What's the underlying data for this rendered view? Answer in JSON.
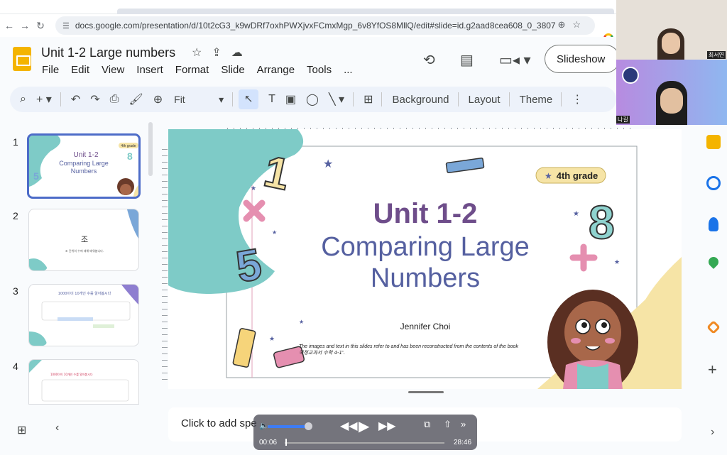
{
  "browser": {
    "url": "docs.google.com/presentation/d/10t2cG3_k9wDRf7oxhPWXjvxFCmxMgp_6v8YfOS8MllQ/edit#slide=id.g2aad8cea608_0_3807"
  },
  "doc": {
    "title": "Unit 1-2 Large numbers",
    "menu": [
      "File",
      "Edit",
      "View",
      "Insert",
      "Format",
      "Slide",
      "Arrange",
      "Tools",
      "..."
    ],
    "slideshow_label": "Slideshow"
  },
  "toolbar": {
    "zoom": "Fit",
    "background": "Background",
    "layout": "Layout",
    "theme": "Theme"
  },
  "thumbnails": [
    {
      "num": "1",
      "line1": "Unit 1-2",
      "line2": "Comparing Large",
      "line3": "Numbers",
      "badge": "4th grade",
      "selected": true
    },
    {
      "num": "2",
      "char": "조",
      "sub": "조 단위의 수에 대해 배워봅니다."
    },
    {
      "num": "3",
      "title": "1000이이 10개인 수를 알아봅시다"
    },
    {
      "num": "4",
      "title": "1000이이 10개인 수를 알아봅시다"
    }
  ],
  "slide": {
    "badge": "4th grade",
    "title_line1": "Unit 1-2",
    "title_line2": "Comparing Large",
    "title_line3": "Numbers",
    "author": "Jennifer Choi",
    "note_line1": "The images and text in this slides  refer to and has been reconstructed from the contents of the book",
    "note_line2": "국정교과서 수학 4-1'."
  },
  "notes": {
    "placeholder": "Click to add spe"
  },
  "player": {
    "current": "00:06",
    "total": "28:46",
    "progress": 0.0035
  },
  "video_call": {
    "person1": "최서연",
    "person2": "나길"
  },
  "colors": {
    "accent": "#4d6cc8",
    "teal": "#7ecbc7",
    "purple": "#6e4d8a",
    "indigo": "#5560a0",
    "yellow": "#f6e4a6"
  }
}
